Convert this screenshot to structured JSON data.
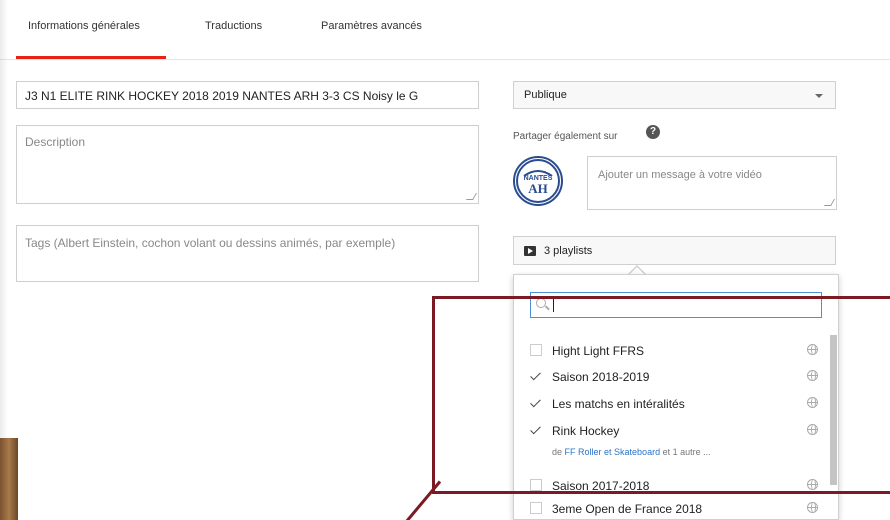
{
  "tabs": [
    {
      "label": "Informations générales",
      "active": true
    },
    {
      "label": "Traductions",
      "active": false
    },
    {
      "label": "Paramètres avancés",
      "active": false
    }
  ],
  "form": {
    "title_value": "J3 N1 ELITE RINK HOCKEY 2018 2019 NANTES ARH 3-3 CS Noisy le G",
    "description_placeholder": "Description",
    "tags_placeholder": "Tags (Albert Einstein, cochon volant ou dessins animés, par exemple)"
  },
  "visibility": {
    "selected": "Publique"
  },
  "share": {
    "label": "Partager également sur",
    "help_icon": "question-icon",
    "message_placeholder": "Ajouter un message à votre vidéo",
    "logo_text": "NANTES A.H"
  },
  "playlists": {
    "button_label": "3 playlists",
    "search_value": "",
    "items": [
      {
        "label": "Hight Light FFRS",
        "checked": false
      },
      {
        "label": "Saison 2018-2019",
        "checked": true
      },
      {
        "label": "Les matchs en intéralités",
        "checked": true
      },
      {
        "label": "Rink Hockey",
        "checked": true
      },
      {
        "label": "Saison 2017-2018",
        "checked": false
      },
      {
        "label": "3eme Open de France 2018",
        "checked": false
      }
    ],
    "owner_prefix": "de",
    "owner_name": "FF Roller et Skateboard",
    "owner_suffix": "et 1 autre ..."
  },
  "colors": {
    "accent_tab": "#e62117",
    "highlight_box": "#7b1a23",
    "link": "#2b74c7"
  }
}
